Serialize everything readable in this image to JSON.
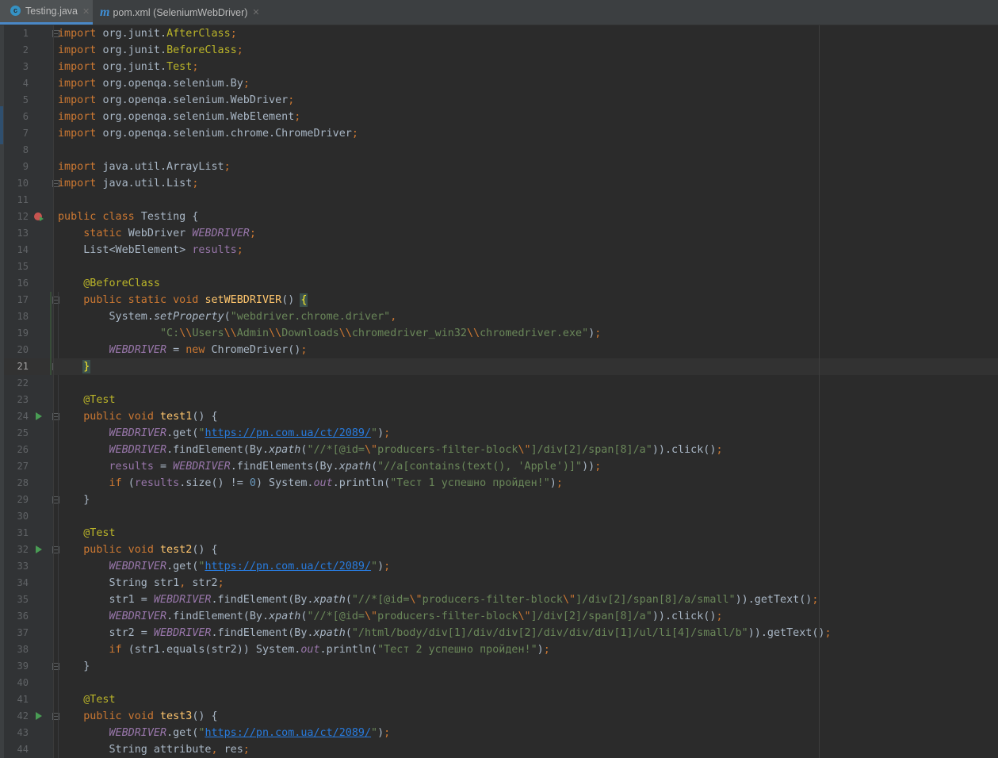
{
  "tabs": [
    {
      "label": "Testing.java",
      "icon": "java-class-icon",
      "active": true
    },
    {
      "label": "pom.xml (SeleniumWebDriver)",
      "icon": "maven-icon",
      "active": false
    }
  ],
  "colors": {
    "background": "#2b2b2b",
    "keyword": "#cc7832",
    "string": "#6a8759",
    "annotation": "#bbb529",
    "field": "#9876aa",
    "number": "#6897bb",
    "method_decl": "#ffc66d",
    "default_text": "#a9b7c6"
  },
  "editor": {
    "current_line": 21,
    "lines": [
      {
        "n": "1",
        "t": [
          [
            "kw",
            "import "
          ],
          [
            "",
            "org.junit."
          ],
          [
            "ann",
            "AfterClass"
          ],
          [
            "kw",
            ";"
          ]
        ]
      },
      {
        "n": "2",
        "t": [
          [
            "kw",
            "import "
          ],
          [
            "",
            "org.junit."
          ],
          [
            "ann",
            "BeforeClass"
          ],
          [
            "kw",
            ";"
          ]
        ]
      },
      {
        "n": "3",
        "t": [
          [
            "kw",
            "import "
          ],
          [
            "",
            "org.junit."
          ],
          [
            "ann",
            "Test"
          ],
          [
            "kw",
            ";"
          ]
        ]
      },
      {
        "n": "4",
        "t": [
          [
            "kw",
            "import "
          ],
          [
            "",
            "org.openqa.selenium.By"
          ],
          [
            "kw",
            ";"
          ]
        ]
      },
      {
        "n": "5",
        "t": [
          [
            "kw",
            "import "
          ],
          [
            "",
            "org.openqa.selenium.WebDriver"
          ],
          [
            "kw",
            ";"
          ]
        ]
      },
      {
        "n": "6",
        "t": [
          [
            "kw",
            "import "
          ],
          [
            "",
            "org.openqa.selenium.WebElement"
          ],
          [
            "kw",
            ";"
          ]
        ]
      },
      {
        "n": "7",
        "t": [
          [
            "kw",
            "import "
          ],
          [
            "",
            "org.openqa.selenium.chrome.ChromeDriver"
          ],
          [
            "kw",
            ";"
          ]
        ]
      },
      {
        "n": "8",
        "t": []
      },
      {
        "n": "9",
        "t": [
          [
            "kw",
            "import "
          ],
          [
            "",
            "java.util.ArrayList"
          ],
          [
            "kw",
            ";"
          ]
        ]
      },
      {
        "n": "10",
        "t": [
          [
            "kw",
            "import "
          ],
          [
            "",
            "java.util.List"
          ],
          [
            "kw",
            ";"
          ]
        ]
      },
      {
        "n": "11",
        "t": []
      },
      {
        "n": "12",
        "t": [
          [
            "kw",
            "public class "
          ],
          [
            "",
            "Testing {"
          ]
        ]
      },
      {
        "n": "13",
        "t": [
          [
            "",
            "    "
          ],
          [
            "kw",
            "static "
          ],
          [
            "",
            "WebDriver "
          ],
          [
            "field",
            "WEBDRIVER"
          ],
          [
            "kw",
            ";"
          ]
        ]
      },
      {
        "n": "14",
        "t": [
          [
            "",
            "    List<WebElement> "
          ],
          [
            "ifield",
            "results"
          ],
          [
            "kw",
            ";"
          ]
        ]
      },
      {
        "n": "15",
        "t": []
      },
      {
        "n": "16",
        "t": [
          [
            "",
            "    "
          ],
          [
            "ann",
            "@BeforeClass"
          ]
        ]
      },
      {
        "n": "17",
        "t": [
          [
            "",
            "    "
          ],
          [
            "kw",
            "public static void "
          ],
          [
            "meth",
            "setWEBDRIVER"
          ],
          [
            "",
            "() "
          ],
          [
            "brace-hl",
            "{"
          ]
        ]
      },
      {
        "n": "18",
        "t": [
          [
            "",
            "        System."
          ],
          [
            "it",
            "setProperty"
          ],
          [
            "",
            "("
          ],
          [
            "str",
            "\"webdriver.chrome.driver\""
          ],
          [
            "kw",
            ","
          ]
        ]
      },
      {
        "n": "19",
        "t": [
          [
            "",
            "                "
          ],
          [
            "str",
            "\"C:"
          ],
          [
            "esc",
            "\\\\"
          ],
          [
            "str",
            "Users"
          ],
          [
            "esc",
            "\\\\"
          ],
          [
            "str",
            "Admin"
          ],
          [
            "esc",
            "\\\\"
          ],
          [
            "str",
            "Downloads"
          ],
          [
            "esc",
            "\\\\"
          ],
          [
            "str",
            "chromedriver_win32"
          ],
          [
            "esc",
            "\\\\"
          ],
          [
            "str",
            "chromedriver.exe\""
          ],
          [
            "",
            ")"
          ],
          [
            "kw",
            ";"
          ]
        ]
      },
      {
        "n": "20",
        "t": [
          [
            "",
            "        "
          ],
          [
            "field",
            "WEBDRIVER"
          ],
          [
            "",
            " = "
          ],
          [
            "kw",
            "new "
          ],
          [
            "",
            "ChromeDriver()"
          ],
          [
            "kw",
            ";"
          ]
        ]
      },
      {
        "n": "21",
        "t": [
          [
            "",
            "    "
          ],
          [
            "brace-hl",
            "}"
          ],
          [
            "caret",
            ""
          ]
        ]
      },
      {
        "n": "22",
        "t": []
      },
      {
        "n": "23",
        "t": [
          [
            "",
            "    "
          ],
          [
            "ann",
            "@Test"
          ]
        ]
      },
      {
        "n": "24",
        "t": [
          [
            "",
            "    "
          ],
          [
            "kw",
            "public void "
          ],
          [
            "meth",
            "test1"
          ],
          [
            "",
            "() {"
          ]
        ]
      },
      {
        "n": "25",
        "t": [
          [
            "",
            "        "
          ],
          [
            "field",
            "WEBDRIVER"
          ],
          [
            "",
            ".get("
          ],
          [
            "str",
            "\""
          ],
          [
            "link",
            "https://pn.com.ua/ct/2089/"
          ],
          [
            "str",
            "\""
          ],
          [
            "",
            ")"
          ],
          [
            "kw",
            ";"
          ]
        ]
      },
      {
        "n": "26",
        "t": [
          [
            "",
            "        "
          ],
          [
            "field",
            "WEBDRIVER"
          ],
          [
            "",
            ".findElement(By."
          ],
          [
            "it",
            "xpath"
          ],
          [
            "",
            "("
          ],
          [
            "str",
            "\"//*[@id="
          ],
          [
            "esc",
            "\\\""
          ],
          [
            "str",
            "producers-filter-block"
          ],
          [
            "esc",
            "\\\""
          ],
          [
            "str",
            "]/div[2]/span[8]/a\""
          ],
          [
            "",
            "))"
          ],
          [
            "",
            ".click()"
          ],
          [
            "kw",
            ";"
          ]
        ]
      },
      {
        "n": "27",
        "t": [
          [
            "",
            "        "
          ],
          [
            "ifield",
            "results"
          ],
          [
            "",
            " = "
          ],
          [
            "field",
            "WEBDRIVER"
          ],
          [
            "",
            ".findElements(By."
          ],
          [
            "it",
            "xpath"
          ],
          [
            "",
            "("
          ],
          [
            "str",
            "\"//a[contains(text(), 'Apple')]\""
          ],
          [
            "",
            "))"
          ],
          [
            "kw",
            ";"
          ]
        ]
      },
      {
        "n": "28",
        "t": [
          [
            "",
            "        "
          ],
          [
            "kw",
            "if "
          ],
          [
            "",
            "("
          ],
          [
            "ifield",
            "results"
          ],
          [
            "",
            ".size() != "
          ],
          [
            "num",
            "0"
          ],
          [
            "",
            ") System."
          ],
          [
            "field",
            "out"
          ],
          [
            "",
            ".println("
          ],
          [
            "str",
            "\"Тест 1 успешно пройден!\""
          ],
          [
            "",
            ")"
          ],
          [
            "kw",
            ";"
          ]
        ]
      },
      {
        "n": "29",
        "t": [
          [
            "",
            "    }"
          ]
        ]
      },
      {
        "n": "30",
        "t": []
      },
      {
        "n": "31",
        "t": [
          [
            "",
            "    "
          ],
          [
            "ann",
            "@Test"
          ]
        ]
      },
      {
        "n": "32",
        "t": [
          [
            "",
            "    "
          ],
          [
            "kw",
            "public void "
          ],
          [
            "meth",
            "test2"
          ],
          [
            "",
            "() {"
          ]
        ]
      },
      {
        "n": "33",
        "t": [
          [
            "",
            "        "
          ],
          [
            "field",
            "WEBDRIVER"
          ],
          [
            "",
            ".get("
          ],
          [
            "str",
            "\""
          ],
          [
            "link",
            "https://pn.com.ua/ct/2089/"
          ],
          [
            "str",
            "\""
          ],
          [
            "",
            ")"
          ],
          [
            "kw",
            ";"
          ]
        ]
      },
      {
        "n": "34",
        "t": [
          [
            "",
            "        String str1"
          ],
          [
            "kw",
            ", "
          ],
          [
            "",
            "str2"
          ],
          [
            "kw",
            ";"
          ]
        ]
      },
      {
        "n": "35",
        "t": [
          [
            "",
            "        str1 = "
          ],
          [
            "field",
            "WEBDRIVER"
          ],
          [
            "",
            ".findElement(By."
          ],
          [
            "it",
            "xpath"
          ],
          [
            "",
            "("
          ],
          [
            "str",
            "\"//*[@id="
          ],
          [
            "esc",
            "\\\""
          ],
          [
            "str",
            "producers-filter-block"
          ],
          [
            "esc",
            "\\\""
          ],
          [
            "str",
            "]/div[2]/span[8]/a/small\""
          ],
          [
            "",
            "))"
          ],
          [
            "",
            ".getText()"
          ],
          [
            "kw",
            ";"
          ]
        ]
      },
      {
        "n": "36",
        "t": [
          [
            "",
            "        "
          ],
          [
            "field",
            "WEBDRIVER"
          ],
          [
            "",
            ".findElement(By."
          ],
          [
            "it",
            "xpath"
          ],
          [
            "",
            "("
          ],
          [
            "str",
            "\"//*[@id="
          ],
          [
            "esc",
            "\\\""
          ],
          [
            "str",
            "producers-filter-block"
          ],
          [
            "esc",
            "\\\""
          ],
          [
            "str",
            "]/div[2]/span[8]/a\""
          ],
          [
            "",
            "))"
          ],
          [
            "",
            ".click()"
          ],
          [
            "kw",
            ";"
          ]
        ]
      },
      {
        "n": "37",
        "t": [
          [
            "",
            "        str2 = "
          ],
          [
            "field",
            "WEBDRIVER"
          ],
          [
            "",
            ".findElement(By."
          ],
          [
            "it",
            "xpath"
          ],
          [
            "",
            "("
          ],
          [
            "str",
            "\"/html/body/div[1]/div/div[2]/div/div/div[1]/ul/li[4]/small/b\""
          ],
          [
            "",
            "))"
          ],
          [
            "",
            ".getText()"
          ],
          [
            "kw",
            ";"
          ]
        ]
      },
      {
        "n": "38",
        "t": [
          [
            "",
            "        "
          ],
          [
            "kw",
            "if "
          ],
          [
            "",
            "(str1.equals(str2)) System."
          ],
          [
            "field",
            "out"
          ],
          [
            "",
            ".println("
          ],
          [
            "str",
            "\"Тест 2 успешно пройден!\""
          ],
          [
            "",
            ")"
          ],
          [
            "kw",
            ";"
          ]
        ]
      },
      {
        "n": "39",
        "t": [
          [
            "",
            "    }"
          ]
        ]
      },
      {
        "n": "40",
        "t": []
      },
      {
        "n": "41",
        "t": [
          [
            "",
            "    "
          ],
          [
            "ann",
            "@Test"
          ]
        ]
      },
      {
        "n": "42",
        "t": [
          [
            "",
            "    "
          ],
          [
            "kw",
            "public void "
          ],
          [
            "meth",
            "test3"
          ],
          [
            "",
            "() {"
          ]
        ]
      },
      {
        "n": "43",
        "t": [
          [
            "",
            "        "
          ],
          [
            "field",
            "WEBDRIVER"
          ],
          [
            "",
            ".get("
          ],
          [
            "str",
            "\""
          ],
          [
            "link",
            "https://pn.com.ua/ct/2089/"
          ],
          [
            "str",
            "\""
          ],
          [
            "",
            ")"
          ],
          [
            "kw",
            ";"
          ]
        ]
      },
      {
        "n": "44",
        "t": [
          [
            "",
            "        String attribute"
          ],
          [
            "kw",
            ", "
          ],
          [
            "",
            "res"
          ],
          [
            "kw",
            ";"
          ]
        ]
      }
    ],
    "gutter_markers": {
      "run": [
        "24",
        "32",
        "42"
      ],
      "breakpoint_run": [
        "12"
      ],
      "fold": [
        "1",
        "10",
        "17",
        "21",
        "24",
        "29",
        "32",
        "39",
        "42"
      ]
    }
  }
}
